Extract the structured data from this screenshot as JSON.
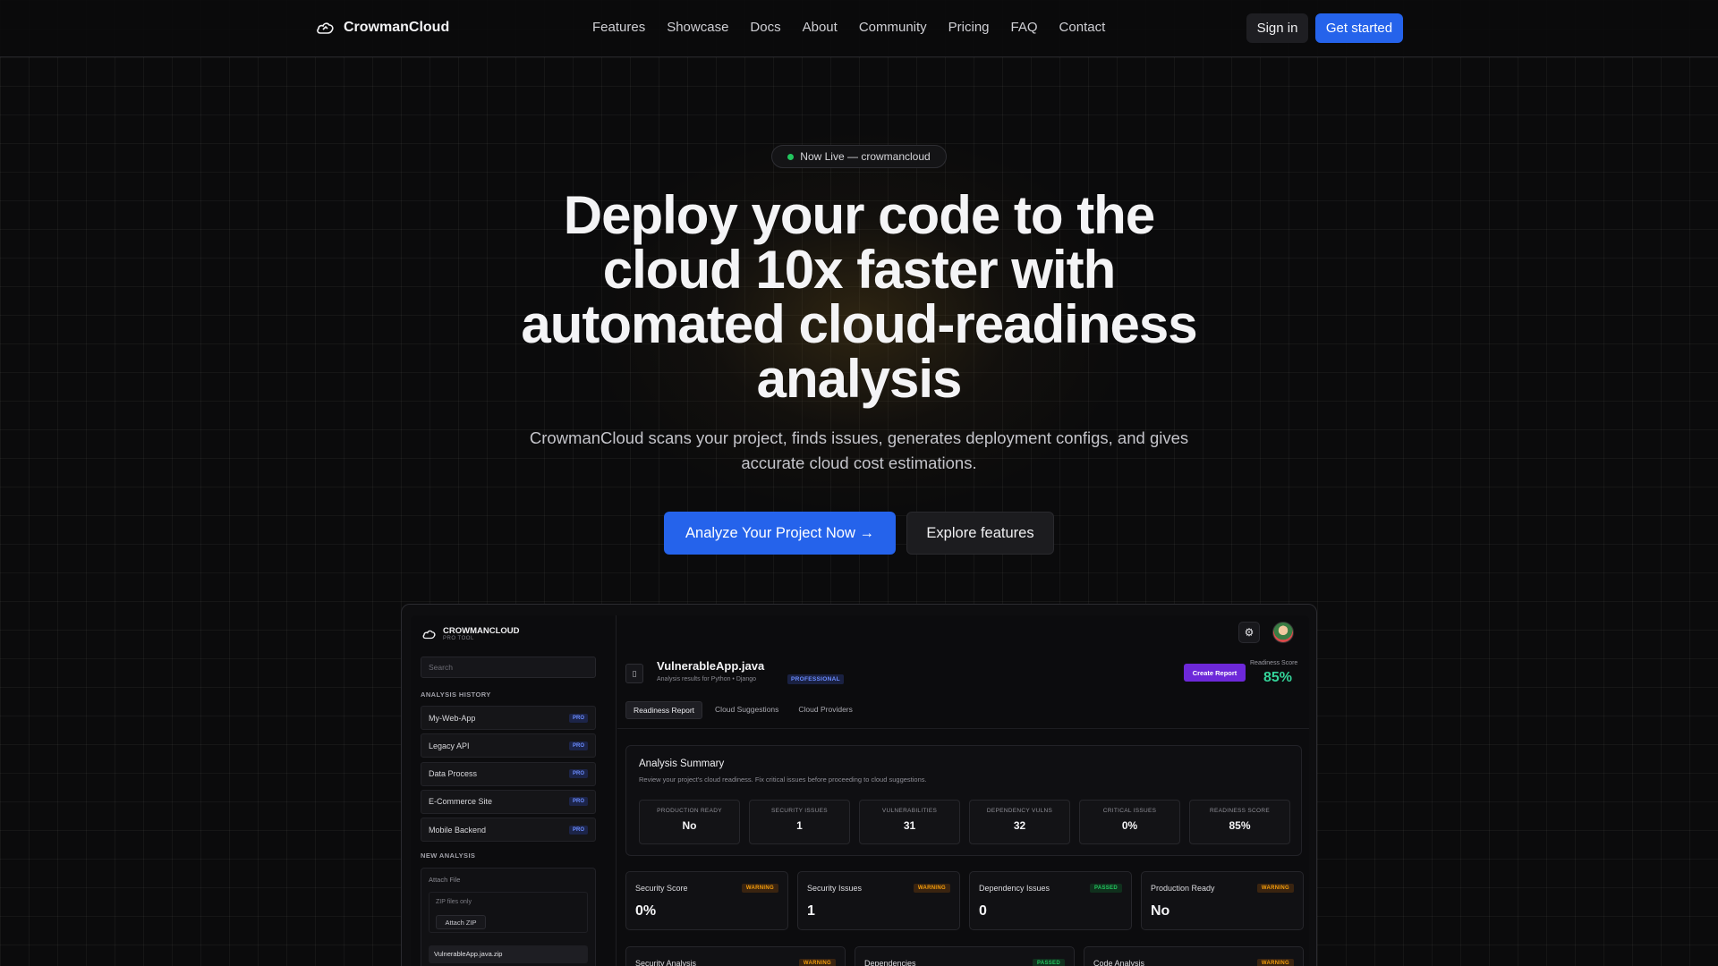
{
  "nav": {
    "brand": "CrowmanCloud",
    "links": [
      "Features",
      "Showcase",
      "Docs",
      "About",
      "Community",
      "Pricing",
      "FAQ",
      "Contact"
    ],
    "signin": "Sign in",
    "get_started": "Get started"
  },
  "hero": {
    "badge": "Now Live — crowmancloud",
    "title": "Deploy your code to the cloud 10x faster with automated cloud-readiness analysis",
    "subtitle": "CrowmanCloud scans your project, finds issues, generates deployment configs, and gives accurate cloud cost estimations.",
    "cta_primary": "Analyze Your Project Now →",
    "cta_secondary": "Explore features"
  },
  "preview": {
    "brand": "CROWMANCLOUD",
    "brand_tag": "PRO TOOL",
    "search_placeholder": "Search",
    "history_heading": "ANALYSIS HISTORY",
    "history": [
      {
        "name": "My-Web-App",
        "tag": "PRO"
      },
      {
        "name": "Legacy API",
        "tag": "PRO"
      },
      {
        "name": "Data Process",
        "tag": "PRO"
      },
      {
        "name": "E-Commerce Site",
        "tag": "PRO"
      },
      {
        "name": "Mobile Backend",
        "tag": "PRO"
      }
    ],
    "new_heading": "NEW ANALYSIS",
    "attach_label": "Attach File",
    "zip_only": "ZIP files only",
    "attach_button": "Attach ZIP",
    "file_name": "VulnerableApp.java.zip",
    "project_title": "VulnerableApp.java",
    "project_subtitle": "Analysis results for Python • Django",
    "plan_tag": "PROFESSIONAL",
    "create_report": "Create Report",
    "score_label": "Readiness Score",
    "score_value": "85%",
    "tabs": [
      "Readiness Report",
      "Cloud Suggestions",
      "Cloud Providers"
    ],
    "summary_title": "Analysis Summary",
    "summary_desc": "Review your project's cloud readiness. Fix critical issues before proceeding to cloud suggestions.",
    "stats": [
      {
        "label": "PRODUCTION READY",
        "value": "No"
      },
      {
        "label": "SECURITY ISSUES",
        "value": "1"
      },
      {
        "label": "VULNERABILITIES",
        "value": "31"
      },
      {
        "label": "DEPENDENCY VULNS",
        "value": "32"
      },
      {
        "label": "CRITICAL ISSUES",
        "value": "0%"
      },
      {
        "label": "READINESS SCORE",
        "value": "85%"
      }
    ],
    "cards": [
      {
        "label": "Security Score",
        "value": "0%",
        "tag": "WARNING",
        "status": "warning"
      },
      {
        "label": "Security Issues",
        "value": "1",
        "tag": "WARNING",
        "status": "warning"
      },
      {
        "label": "Dependency Issues",
        "value": "0",
        "tag": "PASSED",
        "status": "passed"
      },
      {
        "label": "Production Ready",
        "value": "No",
        "tag": "WARNING",
        "status": "warning"
      }
    ],
    "bottom_cards": [
      {
        "label": "Security Analysis",
        "tag": "WARNING",
        "status": "warning"
      },
      {
        "label": "Dependencies",
        "tag": "PASSED",
        "status": "passed"
      },
      {
        "label": "Code Analysis",
        "tag": "WARNING",
        "status": "warning"
      }
    ]
  },
  "colors": {
    "accent": "#2563eb",
    "purple": "#6d28d9",
    "success": "#22c55e",
    "warning": "#f59e0b"
  },
  "icons": {
    "brand": "crow-cloud-icon",
    "settings": "gear-icon",
    "file": "file-icon"
  }
}
